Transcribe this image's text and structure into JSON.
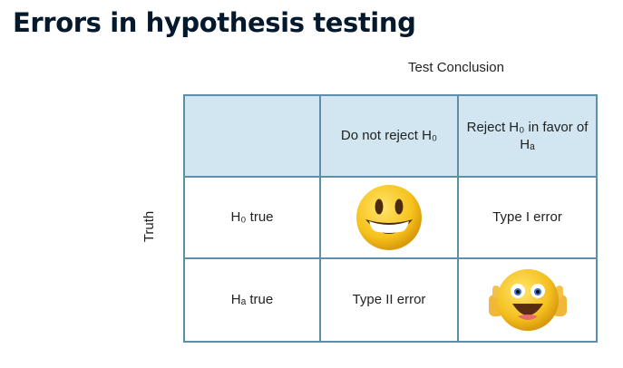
{
  "title": "Errors in hypothesis testing",
  "column_caption": "Test Conclusion",
  "row_caption": "Truth",
  "table": {
    "header": {
      "corner": "",
      "col1": "Do not reject H₀",
      "col2": "Reject H₀ in favor of Hₐ"
    },
    "rows": [
      {
        "label": "H₀ true",
        "col1_icon": "smiling-face-icon",
        "col2": "Type I error"
      },
      {
        "label": "Hₐ true",
        "col1": "Type II error",
        "col2_icon": "thumbs-up-face-icon"
      }
    ]
  },
  "colors": {
    "header_fill": "#d1e6f1",
    "grid_line": "#5f8fa8",
    "title": "#05192d"
  }
}
